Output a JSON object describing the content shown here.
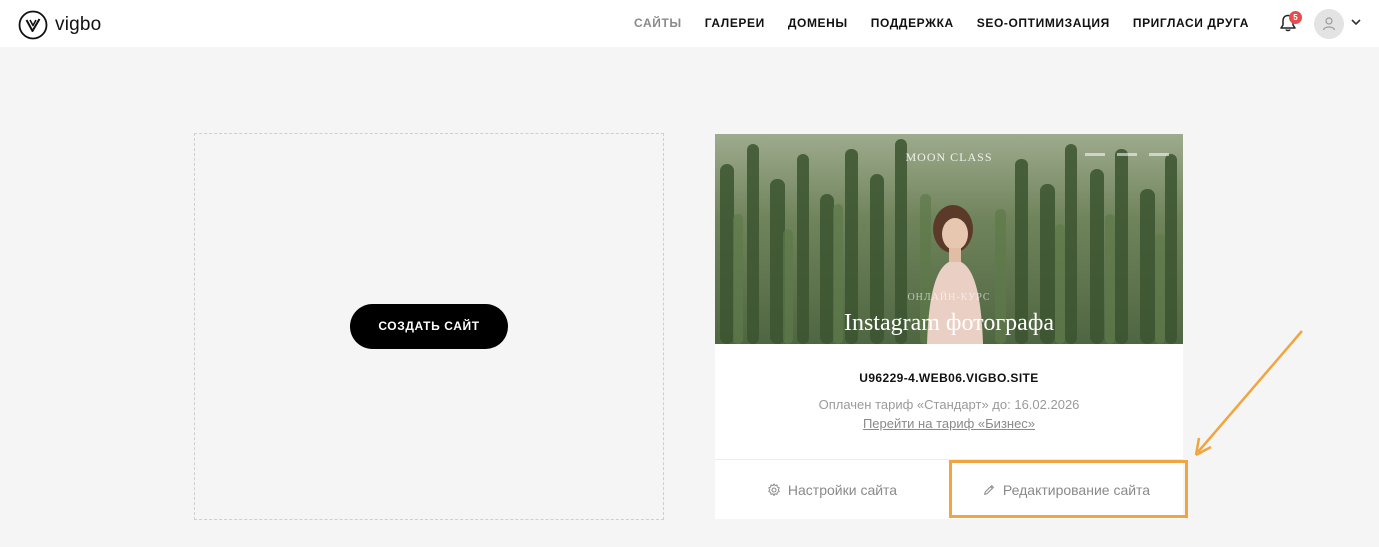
{
  "brand": {
    "name": "vigbo"
  },
  "nav": {
    "items": [
      {
        "label": "САЙТЫ",
        "active": true
      },
      {
        "label": "ГАЛЕРЕИ",
        "active": false
      },
      {
        "label": "ДОМЕНЫ",
        "active": false
      },
      {
        "label": "ПОДДЕРЖКА",
        "active": false
      },
      {
        "label": "SEO-ОПТИМИЗАЦИЯ",
        "active": false
      },
      {
        "label": "ПРИГЛАСИ ДРУГА",
        "active": false
      }
    ]
  },
  "notifications": {
    "count": "5",
    "icon": "bell-icon"
  },
  "user": {
    "icon": "user-icon",
    "menu_icon": "chevron-down-icon"
  },
  "create": {
    "button_label": "СОЗДАТЬ САЙТ"
  },
  "site": {
    "preview": {
      "brand": "MOON CLASS",
      "subtitle": "ОНЛАЙН-КУРС",
      "title": "Instagram фотографа"
    },
    "domain": "U96229-4.WEB06.VIGBO.SITE",
    "plan_text": "Оплачен тариф «Стандарт» до: 16.02.2026",
    "upgrade_link": "Перейти на тариф «Бизнес»",
    "settings_label": "Настройки сайта",
    "edit_label": "Редактирование сайта"
  },
  "colors": {
    "accent_annotation": "#f0a540",
    "badge": "#e94c4c",
    "background": "#f5f5f5",
    "primary_button": "#000000"
  }
}
